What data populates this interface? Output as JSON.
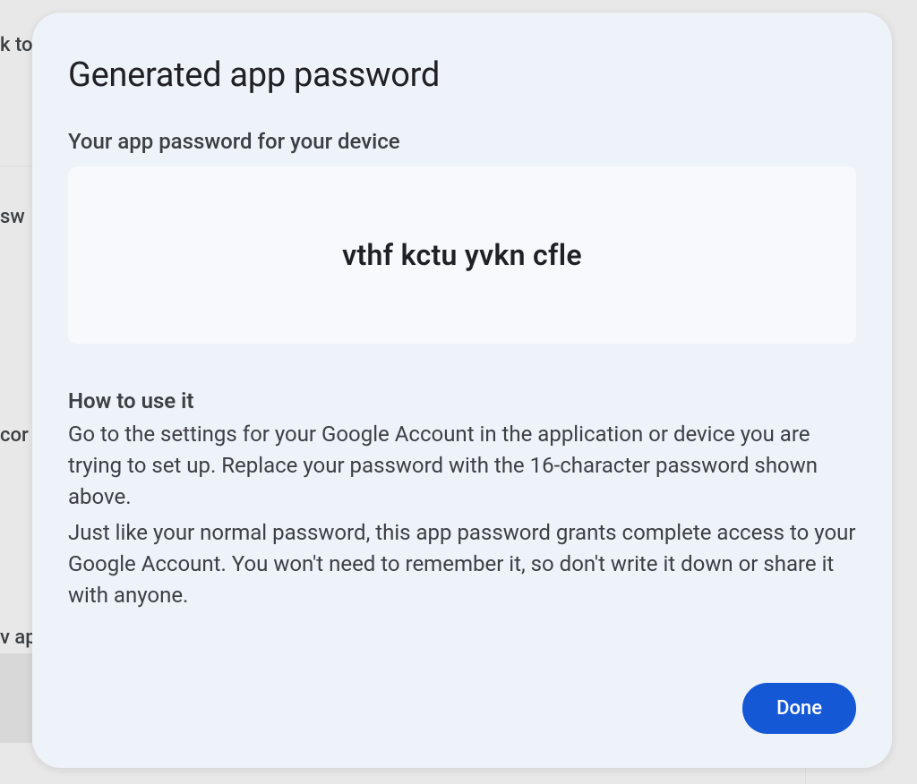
{
  "background": {
    "text1": "k to",
    "text2": "sw",
    "text3": "cor",
    "text4": "v ap"
  },
  "dialog": {
    "title": "Generated app password",
    "subtitle": "Your app password for your device",
    "password": "vthf kctu yvkn cfle",
    "how_to_use_title": "How to use it",
    "instruction1": "Go to the settings for your Google Account in the application or device you are trying to set up. Replace your password with the 16-character password shown above.",
    "instruction2": "Just like your normal password, this app password grants complete access to your Google Account. You won't need to remember it, so don't write it down or share it with anyone.",
    "done_button": "Done"
  }
}
